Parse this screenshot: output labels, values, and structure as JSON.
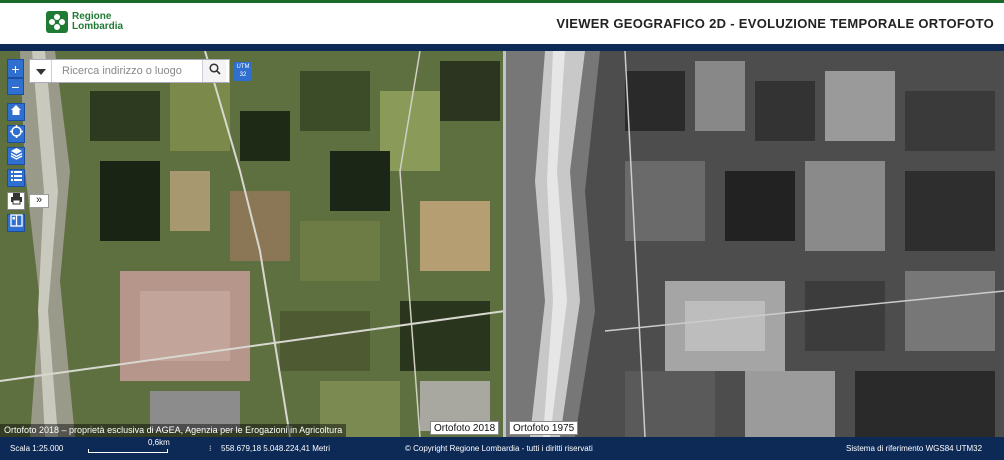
{
  "header": {
    "logo_line1": "Regione",
    "logo_line2": "Lombardia",
    "title": "VIEWER GEOGRAFICO 2D - EVOLUZIONE TEMPORALE ORTOFOTO"
  },
  "controls": {
    "zoom_in": "+",
    "zoom_out": "−",
    "search_placeholder": "Ricerca indirizzo o luogo",
    "utm_badge_line1": "UTM",
    "utm_badge_line2": "32",
    "expand": "»",
    "tools": [
      "home-icon",
      "locate-icon",
      "layers-icon",
      "legend-list-icon",
      "print-icon",
      "compare-icon"
    ]
  },
  "map": {
    "attribution": "Ortofoto 2018 – proprietà esclusiva di AGEA, Agenzia per le Erogazioni in Agricoltura",
    "left_label": "Ortofoto 2018",
    "right_label": "Ortofoto 1975"
  },
  "footer": {
    "scale": "Scala 1:25.000",
    "scale_bar_label": "0,6km",
    "coordinates": "558.679,18 5.048.224,41 Metri",
    "copyright": "© Copyright Regione Lombardia - tutti i diritti riservati",
    "reference_system": "Sistema di riferimento WGS84 UTM32"
  },
  "colors": {
    "brand_green": "#1f7a34",
    "navy": "#0d2a57",
    "control_blue": "#2f6fd0"
  }
}
